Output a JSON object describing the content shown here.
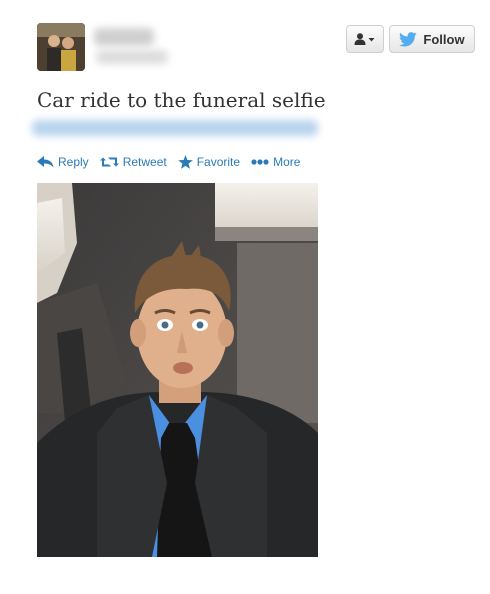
{
  "tweet": {
    "text": "Car ride to the funeral selfie"
  },
  "header": {
    "follow_label": "Follow"
  },
  "actions": {
    "reply": "Reply",
    "retweet": "Retweet",
    "favorite": "Favorite",
    "more": "More"
  },
  "colors": {
    "link": "#2b7bb9",
    "twitter_bird": "#55acee",
    "text": "#333333"
  },
  "icons": [
    "user-icon",
    "caret-down-icon",
    "twitter-bird-icon",
    "reply-icon",
    "retweet-icon",
    "star-icon",
    "more-dots-icon"
  ]
}
